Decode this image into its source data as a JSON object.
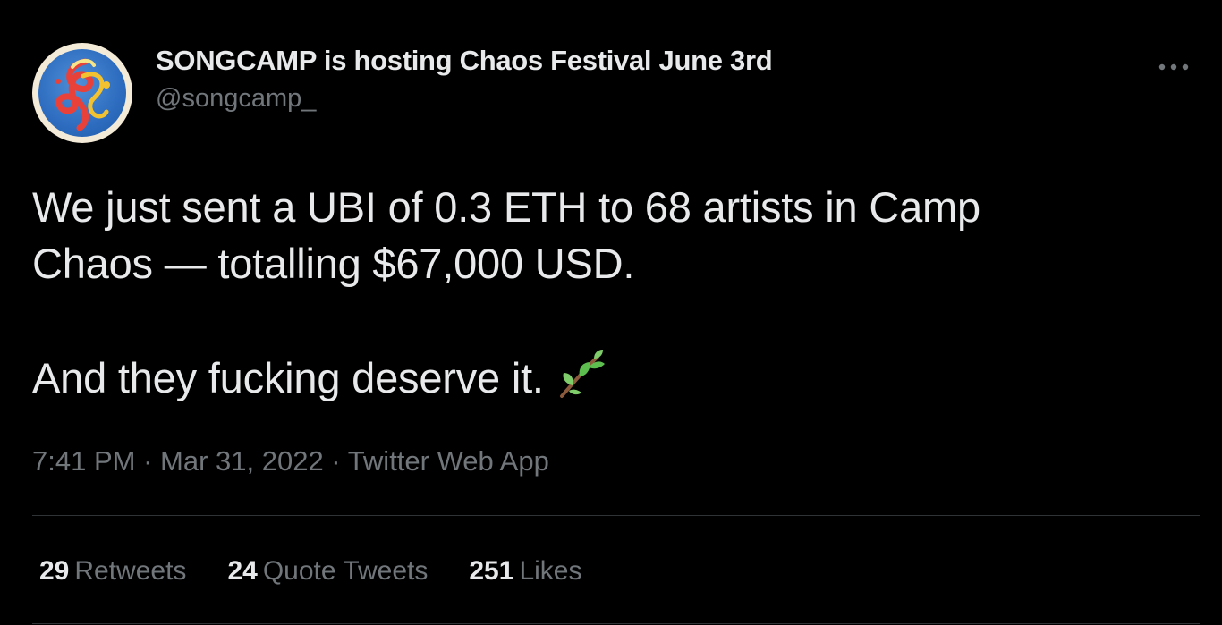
{
  "tweet": {
    "display_name": "SONGCAMP is hosting Chaos Festival June 3rd",
    "handle": "@songcamp_",
    "text_line1": "We just sent a UBI of 0.3 ETH to 68 artists in Camp",
    "text_line2": "Chaos — totalling $67,000 USD.",
    "text_line3": "And they fucking deserve it.",
    "emoji_icon": "herb-emoji-icon",
    "time": "7:41 PM",
    "separator": " · ",
    "date": "Mar 31, 2022",
    "source": "Twitter Web App"
  },
  "stats": {
    "retweets_count": "29",
    "retweets_label": "Retweets",
    "quotes_count": "24",
    "quotes_label": "Quote Tweets",
    "likes_count": "251",
    "likes_label": "Likes"
  },
  "colors": {
    "background": "#000000",
    "primary_text": "#e7e9ea",
    "secondary_text": "#71767b",
    "divider": "#2f3336"
  }
}
